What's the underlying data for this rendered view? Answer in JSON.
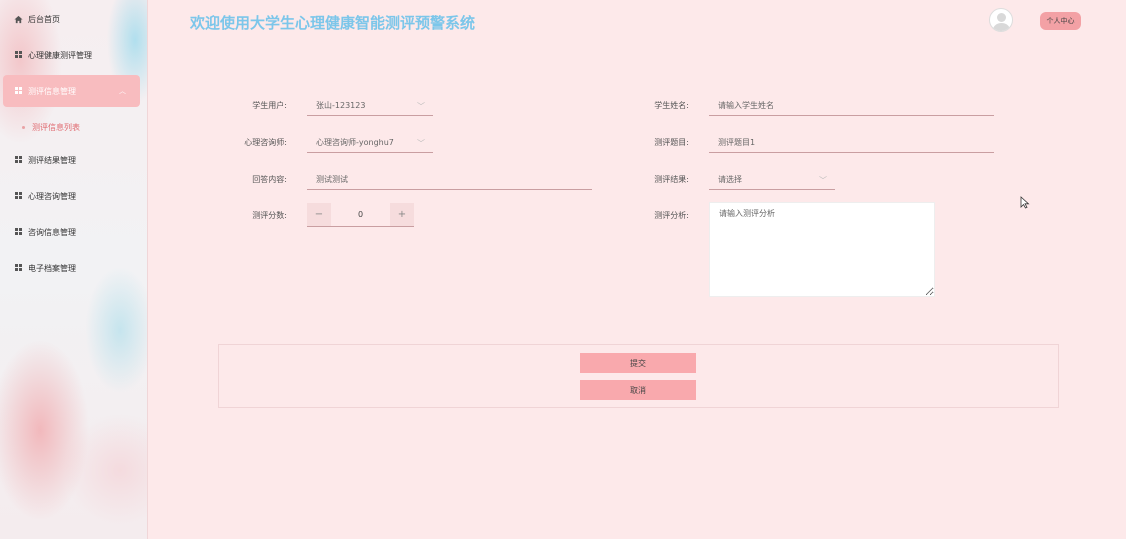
{
  "sidebar": {
    "items": [
      {
        "label": "后台首页",
        "icon": "home-icon"
      },
      {
        "label": "心理健康测评管理",
        "icon": "grid-icon"
      },
      {
        "label": "测评信息管理",
        "icon": "grid-icon",
        "active": true
      },
      {
        "label": "测评结果管理",
        "icon": "grid-icon"
      },
      {
        "label": "心理咨询管理",
        "icon": "grid-icon"
      },
      {
        "label": "咨询信息管理",
        "icon": "grid-icon"
      },
      {
        "label": "电子档案管理",
        "icon": "grid-icon"
      }
    ],
    "sub_item": "测评信息列表"
  },
  "header": {
    "title": "欢迎使用大学生心理健康智能测评预警系统",
    "profile_label": "个人中心"
  },
  "form": {
    "student_user": {
      "label": "学生用户:",
      "value": "张山-123123"
    },
    "student_name": {
      "label": "学生姓名:",
      "placeholder": "请输入学生姓名"
    },
    "counselor": {
      "label": "心理咨询师:",
      "value": "心理咨询师-yonghu7"
    },
    "question": {
      "label": "测评题目:",
      "value": "测评题目1"
    },
    "answer": {
      "label": "回答内容:",
      "value": "测试测试"
    },
    "result": {
      "label": "测评结果:",
      "value": "请选择"
    },
    "score": {
      "label": "测评分数:",
      "value": "0",
      "minus": "−",
      "plus": "+"
    },
    "analysis": {
      "label": "测评分析:",
      "placeholder": "请输入测评分析"
    }
  },
  "actions": {
    "submit": "提交",
    "cancel": "取消"
  },
  "colors": {
    "accent": "#f8bcbf",
    "title": "#7cc6ea",
    "button": "#f9a9ad",
    "background": "#fde9ea"
  }
}
